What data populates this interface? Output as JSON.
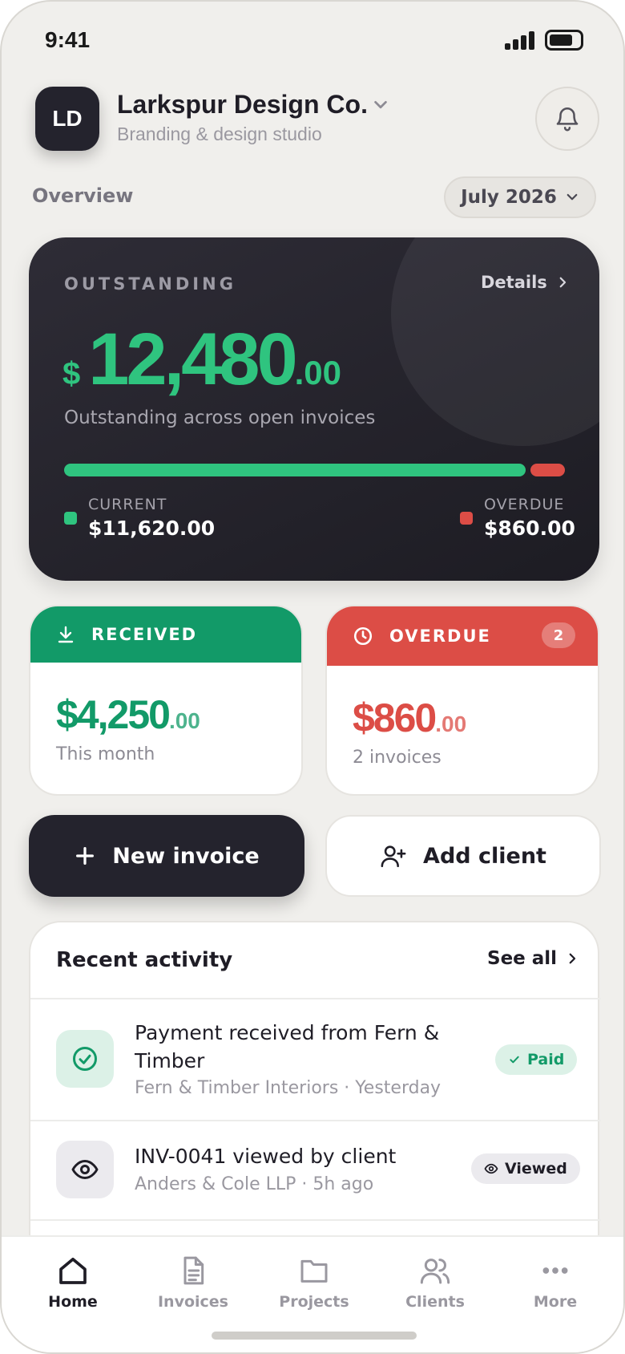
{
  "status_bar": {
    "time": "9:41"
  },
  "header": {
    "avatar_initials": "LD",
    "company_name": "Larkspur Design Co.",
    "tagline": "Branding & design studio"
  },
  "overview": {
    "label": "Overview",
    "period": "July 2026"
  },
  "outstanding": {
    "label": "OUTSTANDING",
    "details_label": "Details",
    "currency_symbol": "$",
    "amount_integer": "12,480",
    "amount_decimal": ".00",
    "subtitle": "Outstanding across open invoices",
    "current_fraction": 0.931,
    "current_label": "CURRENT",
    "current_value": "$11,620.00",
    "overdue_label": "OVERDUE",
    "overdue_value": "$860.00"
  },
  "received": {
    "label": "RECEIVED",
    "amount_integer": "$4,250",
    "amount_decimal": ".00",
    "caption": "This month"
  },
  "overdue_card": {
    "label": "OVERDUE",
    "badge": "2",
    "amount_integer": "$860",
    "amount_decimal": ".00",
    "caption": "2 invoices"
  },
  "actions": {
    "new_invoice": "New invoice",
    "add_client": "Add client"
  },
  "activity": {
    "title": "Recent activity",
    "see_all": "See all",
    "items": [
      {
        "title": "Payment received from Fern & Timber",
        "subtitle": "Fern & Timber Interiors · Yesterday",
        "status": "Paid",
        "icon": "check-circle-icon"
      },
      {
        "title": "INV-0041 viewed by client",
        "subtitle": "Anders & Cole LLP · 5h ago",
        "status": "Viewed",
        "icon": "eye-icon"
      }
    ]
  },
  "tabs": [
    {
      "label": "Home",
      "icon": "home-icon",
      "active": true
    },
    {
      "label": "Invoices",
      "icon": "document-icon",
      "active": false
    },
    {
      "label": "Projects",
      "icon": "folder-icon",
      "active": false
    },
    {
      "label": "Clients",
      "icon": "users-icon",
      "active": false
    },
    {
      "label": "More",
      "icon": "more-dots-icon",
      "active": false
    }
  ],
  "colors": {
    "accent_green": "#2fc47f",
    "received_green": "#129a68",
    "overdue_red": "#dc4d46",
    "dark": "#24232d"
  }
}
